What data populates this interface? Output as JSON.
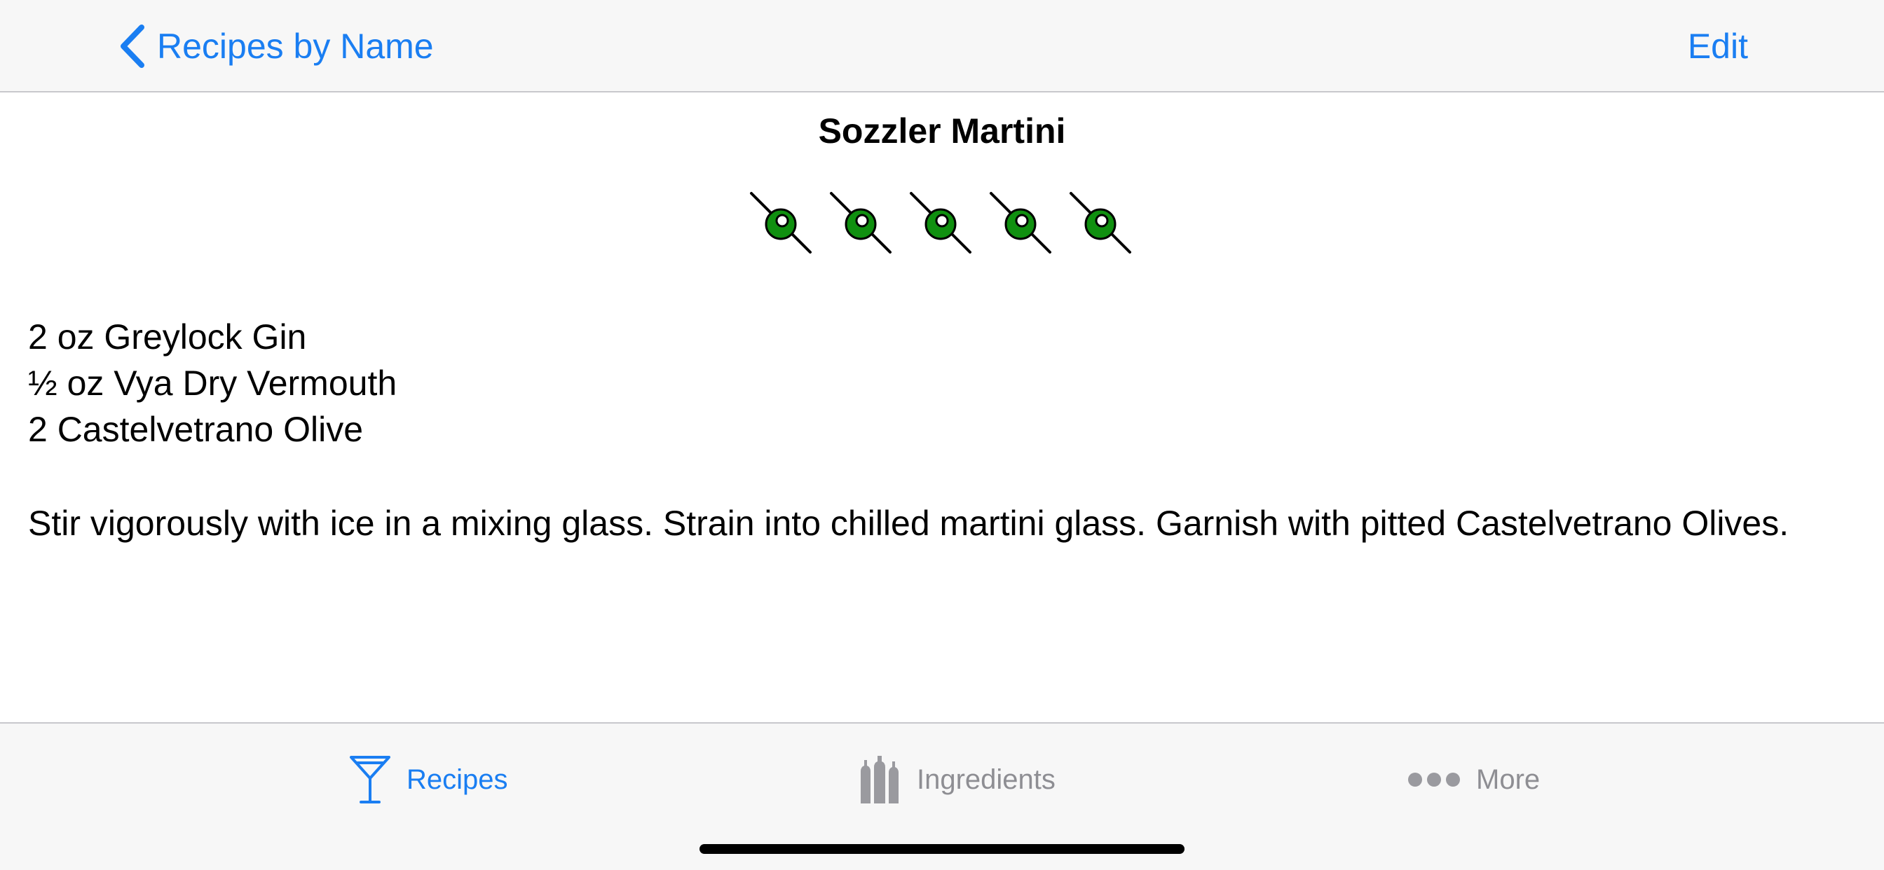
{
  "nav": {
    "back_label": "Recipes by Name",
    "edit_label": "Edit"
  },
  "recipe": {
    "title": "Sozzler Martini",
    "rating": 5,
    "rating_max": 5,
    "rating_icon": "olive-icon",
    "ingredients": [
      "2 oz Greylock Gin",
      "½ oz Vya Dry Vermouth",
      "2 Castelvetrano Olive"
    ],
    "instructions": "Stir vigorously with ice in a mixing glass. Strain into chilled martini glass. Garnish with pitted Castelvetrano Olives."
  },
  "tab_bar": {
    "tabs": [
      {
        "label": "Recipes",
        "icon": "martini-glass-icon",
        "active": true
      },
      {
        "label": "Ingredients",
        "icon": "bottles-icon",
        "active": false
      },
      {
        "label": "More",
        "icon": "more-dots-icon",
        "active": false
      }
    ]
  },
  "colors": {
    "accent": "#1a7ef2",
    "inactive": "#8e8e93",
    "olive_green": "#109010",
    "bar_background": "#f7f7f7"
  }
}
